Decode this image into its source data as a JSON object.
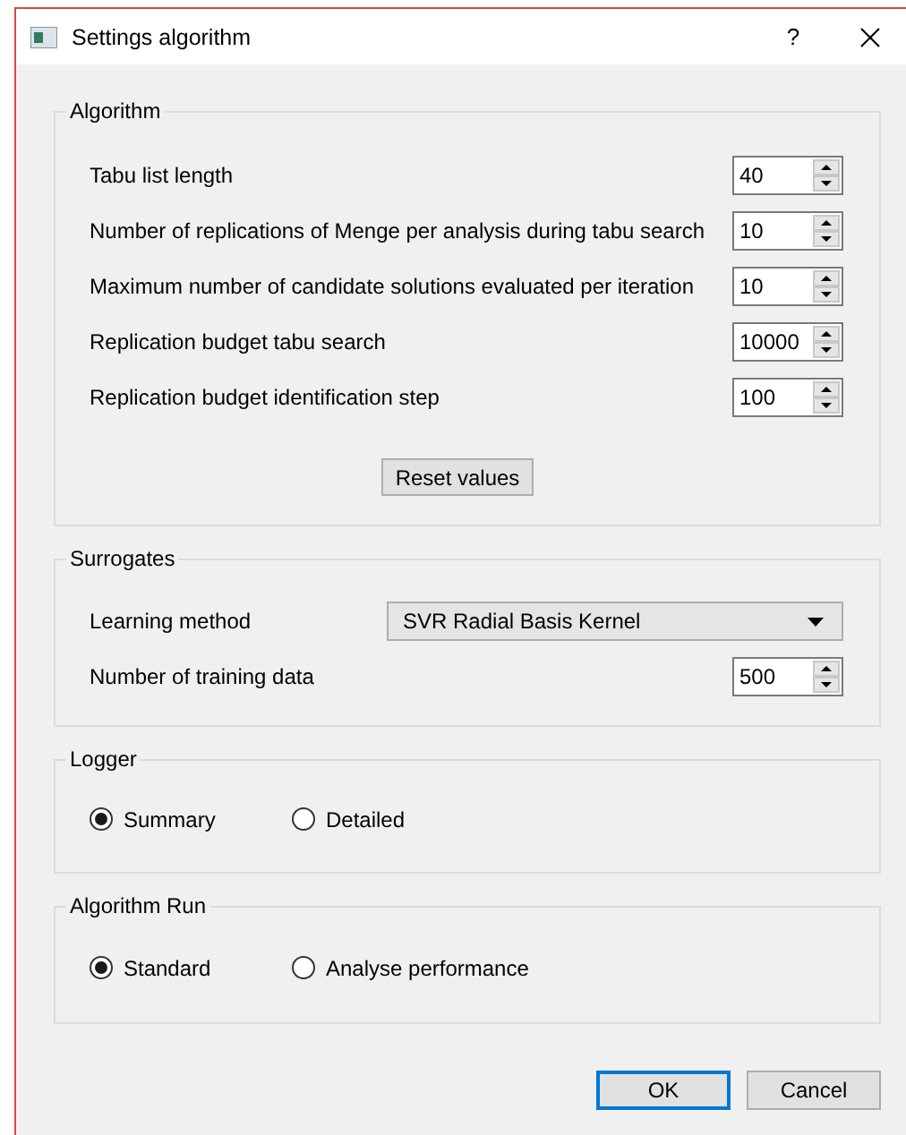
{
  "window": {
    "title": "Settings algorithm",
    "help": "?"
  },
  "algorithm": {
    "title": "Algorithm",
    "fields": [
      {
        "label": "Tabu list length",
        "value": "40"
      },
      {
        "label": "Number of replications of Menge per analysis during tabu search",
        "value": "10"
      },
      {
        "label": "Maximum number of candidate solutions evaluated per iteration",
        "value": "10"
      },
      {
        "label": "Replication budget tabu search",
        "value": "10000"
      },
      {
        "label": "Replication budget identification step",
        "value": "100"
      }
    ],
    "reset_button": "Reset values"
  },
  "surrogates": {
    "title": "Surrogates",
    "learning_method": {
      "label": "Learning method",
      "value": "SVR Radial Basis Kernel"
    },
    "training_data": {
      "label": "Number of training data",
      "value": "500"
    }
  },
  "logger": {
    "title": "Logger",
    "options": [
      {
        "label": "Summary",
        "selected": true
      },
      {
        "label": "Detailed",
        "selected": false
      }
    ]
  },
  "algorithm_run": {
    "title": "Algorithm Run",
    "options": [
      {
        "label": "Standard",
        "selected": true
      },
      {
        "label": "Analyse performance",
        "selected": false
      }
    ]
  },
  "buttons": [
    {
      "label": "OK",
      "default": true
    },
    {
      "label": "Cancel",
      "default": false
    }
  ]
}
